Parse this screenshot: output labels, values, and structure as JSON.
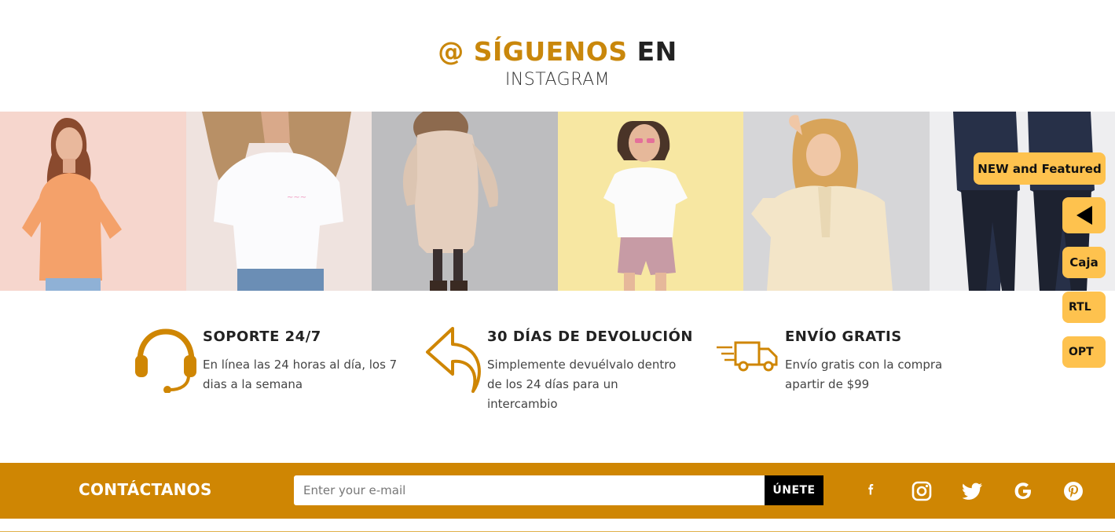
{
  "header": {
    "title_accent": "@ SÍGUENOS",
    "title_rest": "EN",
    "subtitle": "INSTAGRAM"
  },
  "gallery": {
    "items": [
      {
        "name": "woman-orange-tshirt",
        "bg": "#f6d6cd"
      },
      {
        "name": "woman-white-tshirt",
        "bg": "#efe3df"
      },
      {
        "name": "woman-puffer-coat",
        "bg": "#bdbdbf"
      },
      {
        "name": "woman-yellow-bg",
        "bg": "#f7e7a2"
      },
      {
        "name": "woman-trench-coat",
        "bg": "#d6d6d8"
      },
      {
        "name": "men-denim",
        "bg": "#eeeef0"
      }
    ]
  },
  "features": [
    {
      "title": "SOPORTE 24/7",
      "desc": "En línea las 24 horas al día, los 7 dias a la semana",
      "icon": "headset-icon"
    },
    {
      "title": "30 DÍAS DE DEVOLUCIÓN",
      "desc": "Simplemente devuélvalo dentro de los 24 días para un intercambio",
      "icon": "return-arrow-icon"
    },
    {
      "title": "ENVÍO GRATIS",
      "desc": "Envío gratis con la compra apartir de $99",
      "icon": "truck-icon"
    }
  ],
  "footer": {
    "contact_label": "CONTÁCTANOS",
    "email_placeholder": "Enter your e-mail",
    "join_label": "ÚNETE",
    "social": [
      "facebook-icon",
      "instagram-icon",
      "twitter-icon",
      "google-icon",
      "pinterest-icon"
    ]
  },
  "side_panel": {
    "featured_label": "NEW and Featured",
    "caja_label": "Caja",
    "rtl_label": "RTL",
    "opt_label": "OPT"
  },
  "colors": {
    "accent": "#cf8603",
    "side_button": "#fec24e"
  }
}
